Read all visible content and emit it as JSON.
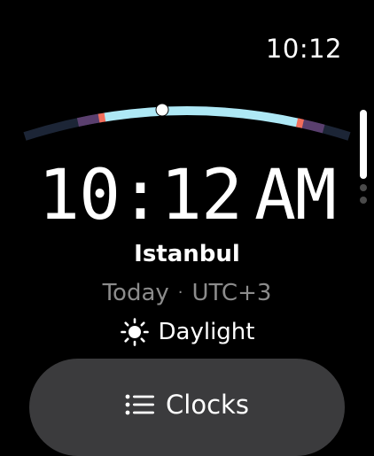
{
  "status_bar": {
    "time": "10:12"
  },
  "clock": {
    "time": "10:12",
    "period": "AM",
    "city": "Istanbul",
    "day": "Today",
    "separator": "·",
    "utc_offset": "UTC+3",
    "daylight_label": "Daylight",
    "daylight_icon": "sun-icon"
  },
  "clocks_button": {
    "label": "Clocks",
    "icon": "list-icon"
  },
  "colors": {
    "background": "#000000",
    "daylight_arc": "#aee8f5",
    "night_arc": "#1c2536",
    "sunrise_marker": "#f26d5b",
    "twilight": "#5a3f6e",
    "button_background": "#3b3b3d",
    "secondary_text": "#8c8c8c"
  }
}
